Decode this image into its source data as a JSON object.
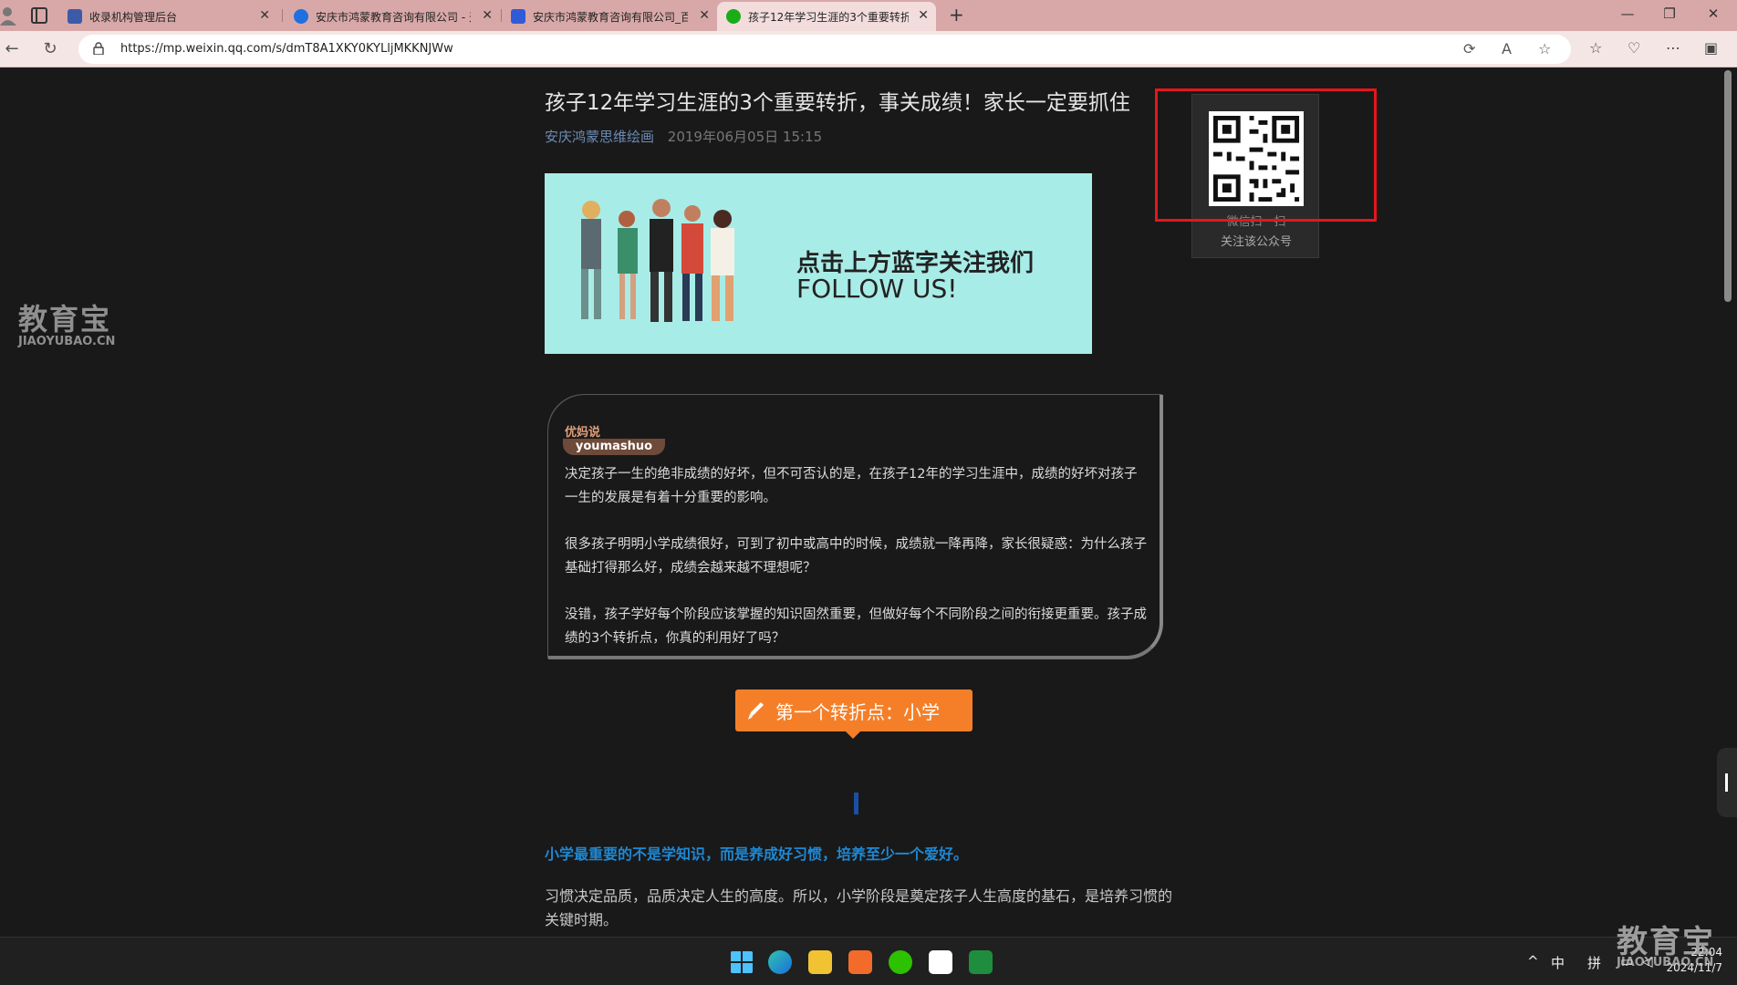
{
  "tabs": [
    {
      "title": "收录机构管理后台",
      "active": false
    },
    {
      "title": "安庆市鸿蒙教育咨询有限公司 - 天",
      "active": false
    },
    {
      "title": "安庆市鸿蒙教育咨询有限公司_百",
      "active": false
    },
    {
      "title": "孩子12年学习生涯的3个重要转折",
      "active": true
    }
  ],
  "address": {
    "url": "https://mp.weixin.qq.com/s/dmT8A1XKY0KYLljMKKNJWw"
  },
  "watermark": {
    "cn": "教育宝",
    "en": "JIAOYUBAO.CN"
  },
  "article": {
    "title": "孩子12年学习生涯的3个重要转折，事关成绩！家长一定要抓住",
    "author": "安庆鸿蒙思维绘画",
    "date": "2019年06月05日 15:15"
  },
  "banner": {
    "line1": "点击上方蓝字关注我们",
    "line2": "FOLLOW US!"
  },
  "qr": {
    "line1": "微信扫一扫",
    "line2": "关注该公众号"
  },
  "card": {
    "brand_cn": "优妈说",
    "brand_en": "youmashuo",
    "p1": "决定孩子一生的绝非成绩的好坏，但不可否认的是，在孩子12年的学习生涯中，成绩的好坏对孩子一生的发展是有着十分重要的影响。",
    "p2": "很多孩子明明小学成绩很好，可到了初中或高中的时候，成绩就一降再降，家长很疑惑：为什么孩子基础打得那么好，成绩会越来越不理想呢？",
    "p3": "没错，孩子学好每个阶段应该掌握的知识固然重要，但做好每个不同阶段之间的衔接更重要。孩子成绩的3个转折点，你真的利用好了吗？"
  },
  "section": {
    "title": "第一个转折点：小学"
  },
  "highlight": "小学最重要的不是学知识，而是养成好习惯，培养至少一个爱好。",
  "body": "习惯决定品质，品质决定人生的高度。所以，小学阶段是奠定孩子人生高度的基石，是培养习惯的关键时期。",
  "taskbar": {
    "tray": {
      "caret": "^",
      "lang1": "中",
      "lang2": "拼"
    },
    "time": "22:04",
    "date": "2024/11/7"
  }
}
